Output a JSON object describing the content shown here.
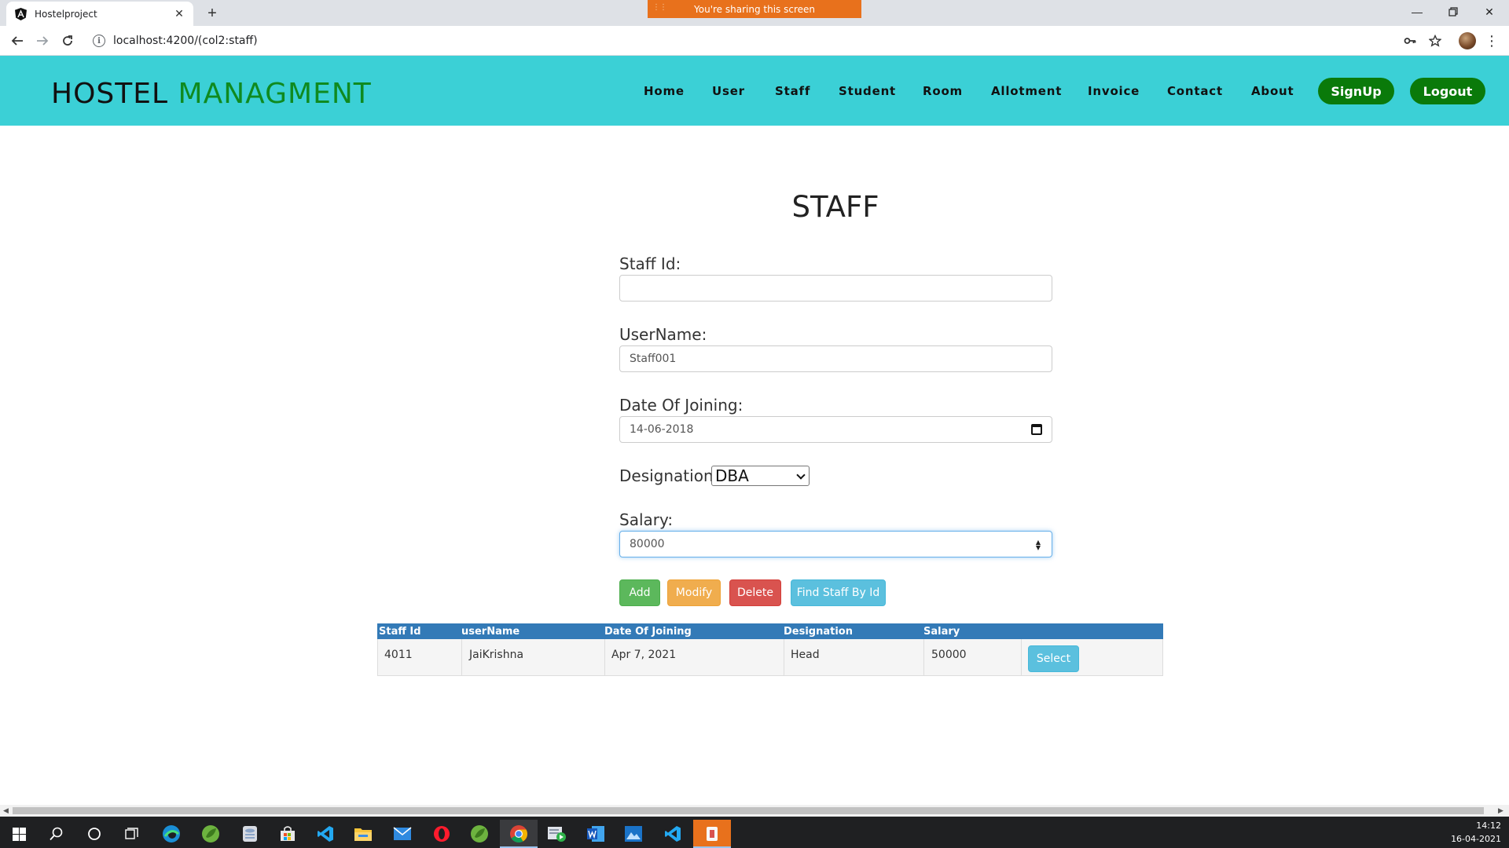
{
  "browser": {
    "tab_title": "Hostelproject",
    "new_tab_symbol": "+",
    "share_banner": "You're sharing this screen",
    "url": "localhost:4200/(col2:staff)"
  },
  "site": {
    "brand_part1": "HOSTEL",
    "brand_part2": "MANAGMENT",
    "nav": [
      "Home",
      "User",
      "Staff",
      "Student",
      "Room",
      "Allotment",
      "Invoice",
      "Contact",
      "About"
    ],
    "signup_label": "SignUp",
    "logout_label": "Logout"
  },
  "form": {
    "title": "STAFF",
    "staff_id_label": "Staff Id:",
    "staff_id_value": "",
    "username_label": "UserName:",
    "username_value": "Staff001",
    "doj_label": "Date Of Joining:",
    "doj_value": "14-06-2018",
    "designation_label": "Designation:",
    "designation_value": "DBA",
    "salary_label": "Salary:",
    "salary_value": "80000",
    "buttons": {
      "add": "Add",
      "modify": "Modify",
      "delete": "Delete",
      "find": "Find Staff By Id"
    }
  },
  "table": {
    "headers": [
      "Staff Id",
      "userName",
      "Date Of Joining",
      "Designation",
      "Salary"
    ],
    "rows": [
      {
        "staff_id": "4011",
        "username": "JaiKrishna",
        "doj": "Apr 7, 2021",
        "designation": "Head",
        "salary": "50000",
        "action": "Select"
      }
    ]
  },
  "taskbar": {
    "time": "14:12",
    "date": "16-04-2021"
  },
  "colors": {
    "header_bg": "#3bd0d6",
    "brand_green": "#0f8a1f",
    "pill_green": "#0a7a0a",
    "btn_add": "#5cb85c",
    "btn_modify": "#f0ad4e",
    "btn_delete": "#d9534f",
    "btn_info": "#5bc0de",
    "table_head": "#337ab7",
    "share_orange": "#e8711c"
  }
}
